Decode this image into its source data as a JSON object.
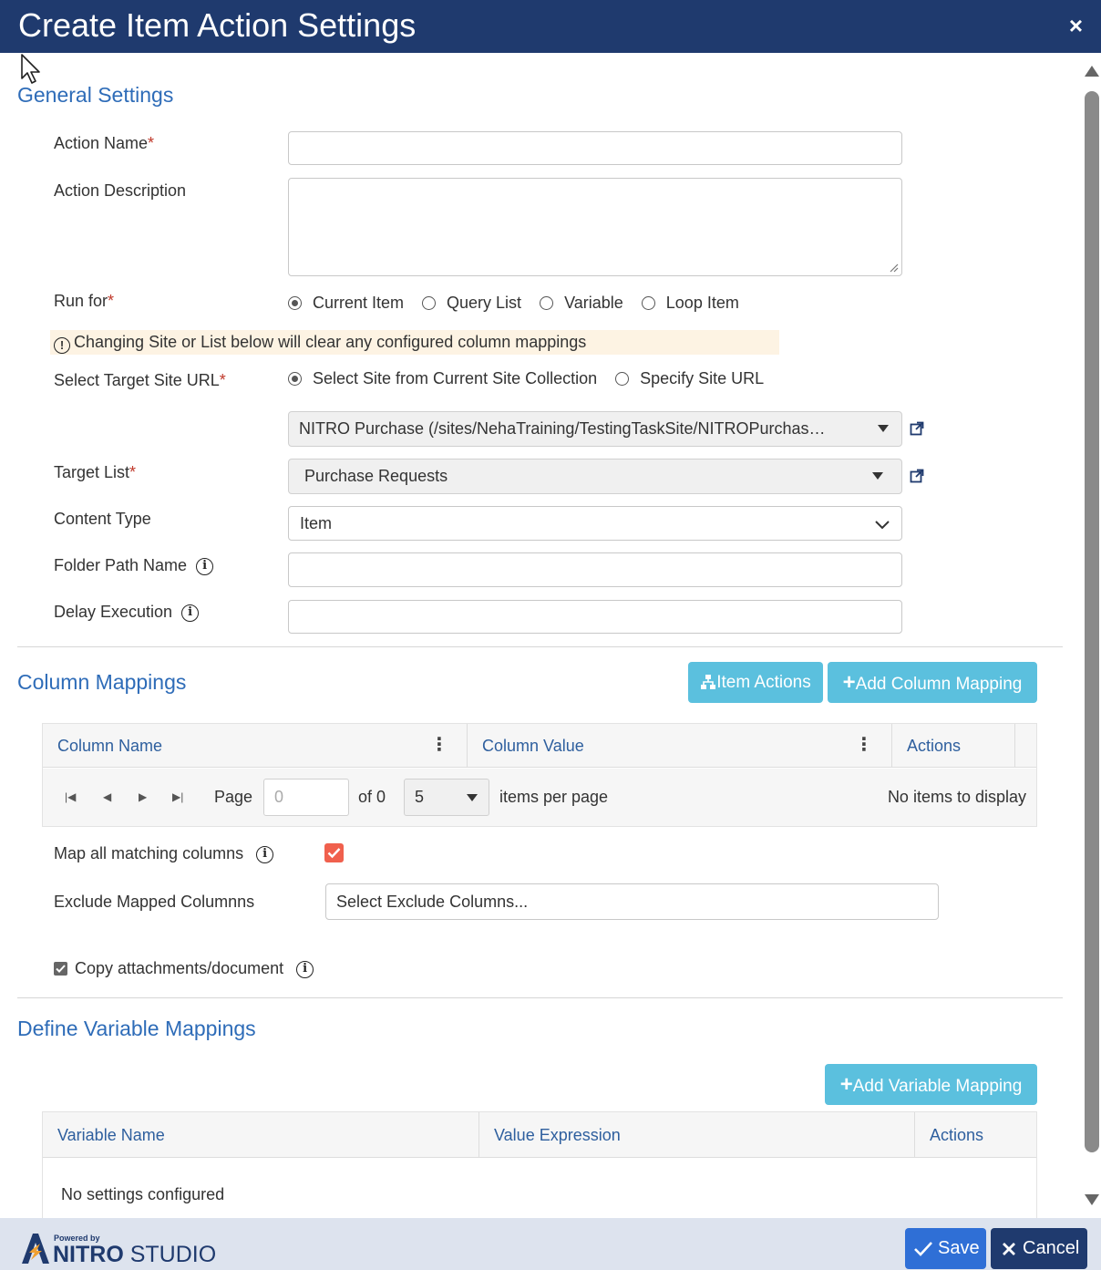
{
  "dialog": {
    "title": "Create Item Action Settings",
    "close_label": "×"
  },
  "general": {
    "title": "General Settings",
    "action_name_label": "Action Name",
    "action_name_value": "",
    "action_description_label": "Action Description",
    "action_description_value": "",
    "run_for_label": "Run for",
    "run_for_options": [
      "Current Item",
      "Query List",
      "Variable",
      "Loop Item"
    ],
    "run_for_selected": "Current Item",
    "warning_text": "Changing Site or List below will clear any configured column mappings",
    "target_site_label": "Select Target Site URL",
    "target_site_options": [
      "Select Site from Current Site Collection",
      "Specify Site URL"
    ],
    "target_site_selected": "Select Site from Current Site Collection",
    "site_dropdown_value": "NITRO Purchase (/sites/NehaTraining/TestingTaskSite/NITROPurchas…",
    "target_list_label": "Target List",
    "target_list_value": "Purchase Requests",
    "content_type_label": "Content Type",
    "content_type_value": "Item",
    "folder_path_label": "Folder Path Name",
    "folder_path_value": "",
    "delay_label": "Delay Execution",
    "delay_value": "",
    "required_mark": "*"
  },
  "column_mappings": {
    "title": "Column Mappings",
    "item_actions_label": "Item Actions",
    "add_column_label": "Add Column Mapping",
    "headers": [
      "Column Name",
      "Column Value",
      "Actions"
    ],
    "pager": {
      "page_label": "Page",
      "page_value": "0",
      "of_label": "of 0",
      "per_page_value": "5",
      "items_per_page_label": "items per page",
      "no_items_text": "No items to display"
    },
    "map_all_label": "Map all matching columns",
    "map_all_checked": true,
    "exclude_label": "Exclude Mapped Columnns",
    "exclude_placeholder": "Select Exclude Columns...",
    "copy_attachments_label": "Copy attachments/document",
    "copy_attachments_checked": true
  },
  "variable_mappings": {
    "title": "Define Variable Mappings",
    "add_variable_label": "Add Variable Mapping",
    "headers": [
      "Variable Name",
      "Value Expression",
      "Actions"
    ],
    "empty_text": "No settings configured"
  },
  "footer": {
    "powered_by": "Powered by",
    "brand_bold": "NITRO",
    "brand_rest": " STUDIO",
    "save_label": "Save",
    "cancel_label": "Cancel"
  },
  "colors": {
    "title_bar": "#1f3a6e",
    "section_title": "#2e6cb8",
    "info_button": "#5bc0de",
    "save_button": "#2f6fd6",
    "cancel_button": "#1f3a6e",
    "checkbox_checked": "#f0604d"
  }
}
